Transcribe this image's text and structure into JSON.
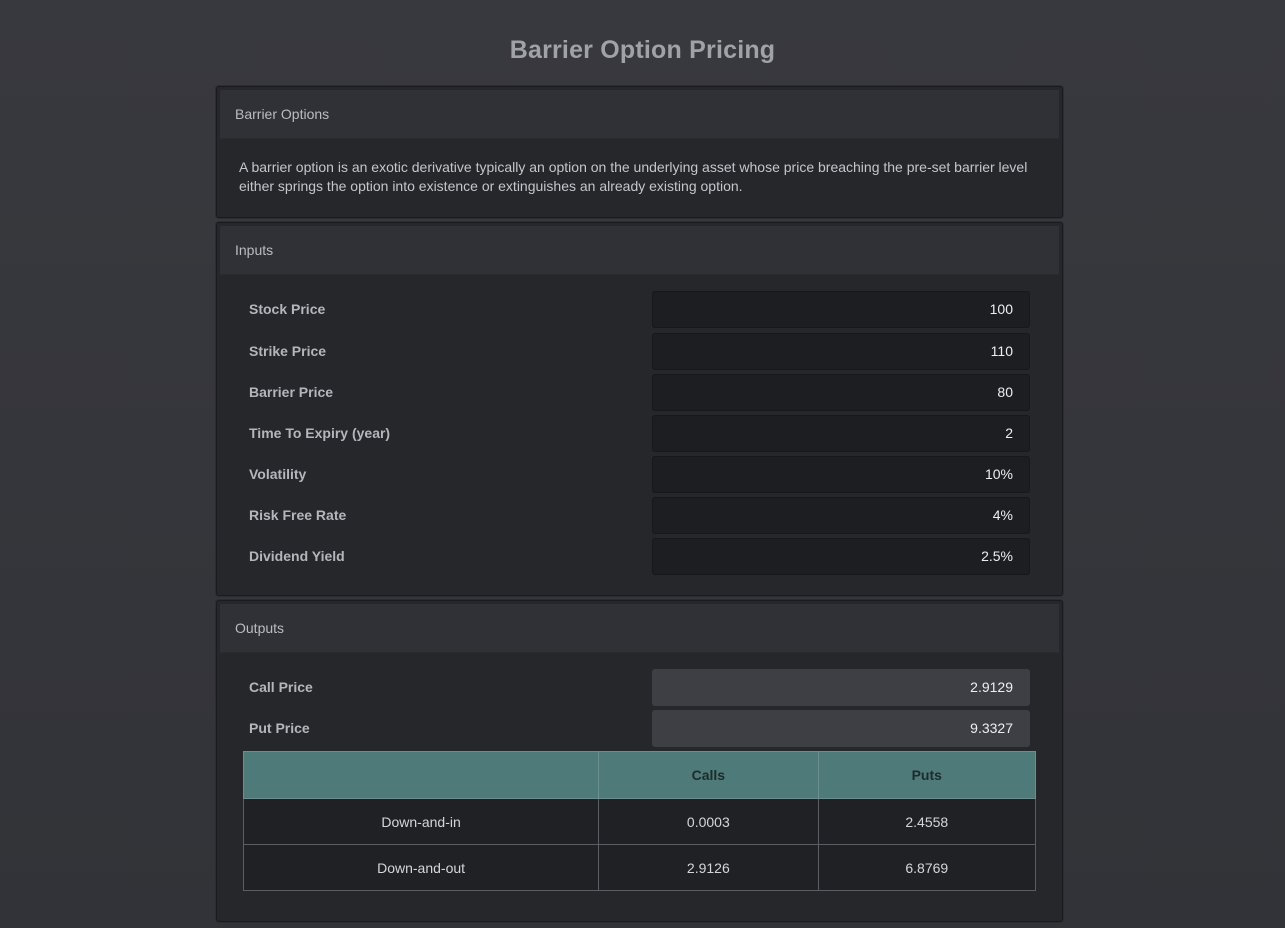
{
  "page": {
    "title": "Barrier Option Pricing"
  },
  "about": {
    "header": "Barrier Options",
    "text": "A barrier option is an exotic derivative typically an option on the underlying asset whose price breaching the pre-set barrier level either springs the option into existence or extinguishes an already existing option."
  },
  "inputs": {
    "header": "Inputs",
    "fields": [
      {
        "label": "Stock Price",
        "value": "100"
      },
      {
        "label": "Strike Price",
        "value": "110"
      },
      {
        "label": "Barrier Price",
        "value": "80"
      },
      {
        "label": "Time To Expiry (year)",
        "value": "2"
      },
      {
        "label": "Volatility",
        "value": "10%"
      },
      {
        "label": "Risk Free Rate",
        "value": "4%"
      },
      {
        "label": "Dividend Yield",
        "value": "2.5%"
      }
    ]
  },
  "outputs": {
    "header": "Outputs",
    "fields": [
      {
        "label": "Call Price",
        "value": "2.9129"
      },
      {
        "label": "Put Price",
        "value": "9.3327"
      }
    ],
    "table": {
      "columns": [
        "",
        "Calls",
        "Puts"
      ],
      "rows": [
        {
          "type": "Down-and-in",
          "calls": "0.0003",
          "puts": "2.4558"
        },
        {
          "type": "Down-and-out",
          "calls": "2.9126",
          "puts": "6.8769"
        }
      ]
    }
  },
  "colors": {
    "background": "#36373c",
    "panel": "#26272b",
    "panel_header": "#303136",
    "input_bg": "#1d1e21",
    "output_bg": "#3e3f44",
    "table_header": "#4e7a79"
  }
}
